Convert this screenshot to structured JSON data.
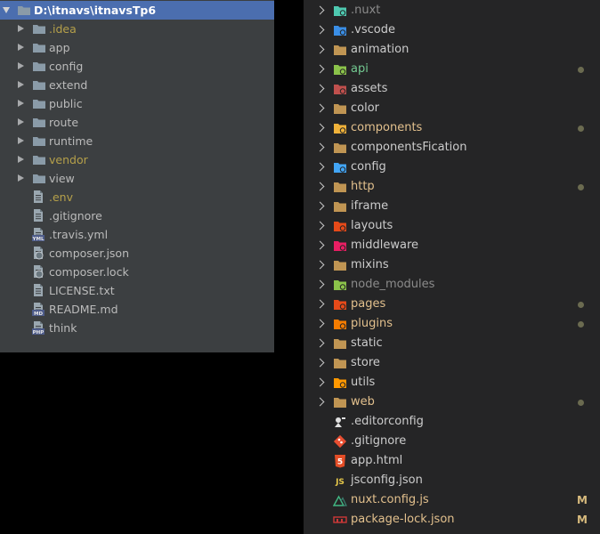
{
  "left": {
    "root": "D:\\itnavs\\itnavsTp6",
    "folders": [
      {
        "name": ".idea",
        "color": "#b5a04a"
      },
      {
        "name": "app",
        "color": "#bbbbbb"
      },
      {
        "name": "config",
        "color": "#bbbbbb"
      },
      {
        "name": "extend",
        "color": "#bbbbbb"
      },
      {
        "name": "public",
        "color": "#bbbbbb"
      },
      {
        "name": "route",
        "color": "#bbbbbb"
      },
      {
        "name": "runtime",
        "color": "#bbbbbb"
      },
      {
        "name": "vendor",
        "color": "#b5a04a"
      },
      {
        "name": "view",
        "color": "#bbbbbb"
      }
    ],
    "files": [
      {
        "name": ".env",
        "color": "#b5a04a",
        "icon": "text-file-icon"
      },
      {
        "name": ".gitignore",
        "color": "#bbbbbb",
        "icon": "text-file-icon"
      },
      {
        "name": ".travis.yml",
        "color": "#bbbbbb",
        "icon": "yml-file-icon",
        "tag": "YML"
      },
      {
        "name": "composer.json",
        "color": "#bbbbbb",
        "icon": "composer-file-icon"
      },
      {
        "name": "composer.lock",
        "color": "#bbbbbb",
        "icon": "composer-file-icon"
      },
      {
        "name": "LICENSE.txt",
        "color": "#bbbbbb",
        "icon": "text-file-icon"
      },
      {
        "name": "README.md",
        "color": "#bbbbbb",
        "icon": "md-file-icon",
        "tag": "MD"
      },
      {
        "name": "think",
        "color": "#bbbbbb",
        "icon": "php-file-icon",
        "tag": "PHP"
      }
    ]
  },
  "right": {
    "folders": [
      {
        "name": ".nuxt",
        "color": "#8b8b8b",
        "icon": "nuxt-folder-icon",
        "iconColor": "#4ec9b0"
      },
      {
        "name": ".vscode",
        "color": "#cccccc",
        "icon": "vscode-folder-icon",
        "iconColor": "#3a8ee6"
      },
      {
        "name": "animation",
        "color": "#cccccc",
        "icon": "folder-icon",
        "iconColor": "#c09553"
      },
      {
        "name": "api",
        "color": "#73c991",
        "icon": "api-folder-icon",
        "iconColor": "#8bc34a",
        "dot": true
      },
      {
        "name": "assets",
        "color": "#cccccc",
        "icon": "assets-folder-icon",
        "iconColor": "#c0504d"
      },
      {
        "name": "color",
        "color": "#cccccc",
        "icon": "folder-icon",
        "iconColor": "#c09553"
      },
      {
        "name": "components",
        "color": "#e2c08d",
        "icon": "components-folder-icon",
        "iconColor": "#f0b23a",
        "dot": true
      },
      {
        "name": "componentsFication",
        "color": "#cccccc",
        "icon": "folder-icon",
        "iconColor": "#c09553"
      },
      {
        "name": "config",
        "color": "#cccccc",
        "icon": "config-folder-icon",
        "iconColor": "#42a5f5"
      },
      {
        "name": "http",
        "color": "#e2c08d",
        "icon": "folder-icon",
        "iconColor": "#c09553",
        "dot": true
      },
      {
        "name": "iframe",
        "color": "#cccccc",
        "icon": "folder-icon",
        "iconColor": "#c09553"
      },
      {
        "name": "layouts",
        "color": "#cccccc",
        "icon": "layouts-folder-icon",
        "iconColor": "#e64a19"
      },
      {
        "name": "middleware",
        "color": "#cccccc",
        "icon": "middleware-folder-icon",
        "iconColor": "#e91e63"
      },
      {
        "name": "mixins",
        "color": "#cccccc",
        "icon": "folder-icon",
        "iconColor": "#c09553"
      },
      {
        "name": "node_modules",
        "color": "#8b8b8b",
        "icon": "node-folder-icon",
        "iconColor": "#8bc34a"
      },
      {
        "name": "pages",
        "color": "#e2c08d",
        "icon": "pages-folder-icon",
        "iconColor": "#e64a19",
        "dot": true
      },
      {
        "name": "plugins",
        "color": "#e2c08d",
        "icon": "plugins-folder-icon",
        "iconColor": "#f57c00",
        "dot": true
      },
      {
        "name": "static",
        "color": "#cccccc",
        "icon": "folder-icon",
        "iconColor": "#c09553"
      },
      {
        "name": "store",
        "color": "#cccccc",
        "icon": "folder-icon",
        "iconColor": "#c09553"
      },
      {
        "name": "utils",
        "color": "#cccccc",
        "icon": "utils-folder-icon",
        "iconColor": "#ff9800"
      },
      {
        "name": "web",
        "color": "#e2c08d",
        "icon": "folder-icon",
        "iconColor": "#c09553",
        "dot": true
      }
    ],
    "files": [
      {
        "name": ".editorconfig",
        "color": "#cccccc",
        "icon": "editorconfig-icon"
      },
      {
        "name": ".gitignore",
        "color": "#cccccc",
        "icon": "git-icon"
      },
      {
        "name": "app.html",
        "color": "#cccccc",
        "icon": "html5-icon",
        "glyph": "5"
      },
      {
        "name": "jsconfig.json",
        "color": "#cccccc",
        "icon": "js-icon",
        "glyph": "JS"
      },
      {
        "name": "nuxt.config.js",
        "color": "#e2c08d",
        "icon": "nuxt-icon",
        "badge": "M"
      },
      {
        "name": "package-lock.json",
        "color": "#e2c08d",
        "icon": "npm-icon",
        "badge": "M"
      }
    ]
  }
}
